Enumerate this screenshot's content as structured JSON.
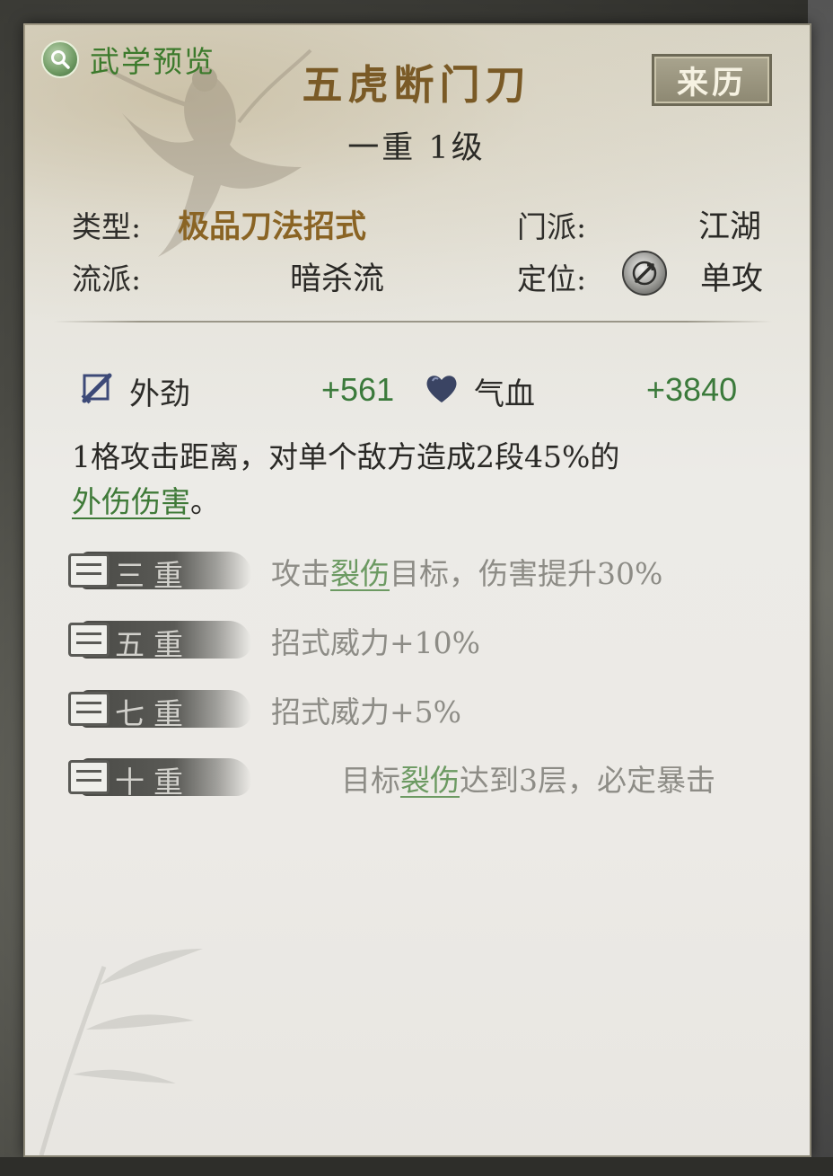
{
  "preview": {
    "label": "武学预览",
    "icon": "search-icon"
  },
  "skill": {
    "name": "五虎断门刀",
    "level": "一重 1级"
  },
  "origin_button": "来历",
  "info": {
    "type_label": "类型:",
    "type_value": "极品刀法招式",
    "school_label": "门派:",
    "school_value": "江湖",
    "style_label": "流派:",
    "style_value": "暗杀流",
    "position_label": "定位:",
    "position_value": "单攻",
    "position_icon": "single-target-icon"
  },
  "stats": [
    {
      "label": "外劲",
      "value": "+561",
      "icon": "sword-icon"
    },
    {
      "label": "气血",
      "value": "+3840",
      "icon": "heart-icon"
    }
  ],
  "description": {
    "text": "1格攻击距离，对单个敌方造成2段45%的",
    "keyword": "外伤伤害",
    "suffix": "。"
  },
  "tiers": [
    {
      "name": "三重",
      "pre": "攻击",
      "keyword": "裂伤",
      "post": "目标，伤害提升30%"
    },
    {
      "name": "五重",
      "pre": "招式威力+10%",
      "keyword": "",
      "post": ""
    },
    {
      "name": "七重",
      "pre": "招式威力+5%",
      "keyword": "",
      "post": ""
    },
    {
      "name": "十重",
      "pre": "目标",
      "keyword": "裂伤",
      "post": "达到3层，必定暴击"
    }
  ],
  "colors": {
    "accent_gold": "#7a5a26",
    "keyword_green": "#3f7a38",
    "stat_green": "#3b7a3b"
  }
}
